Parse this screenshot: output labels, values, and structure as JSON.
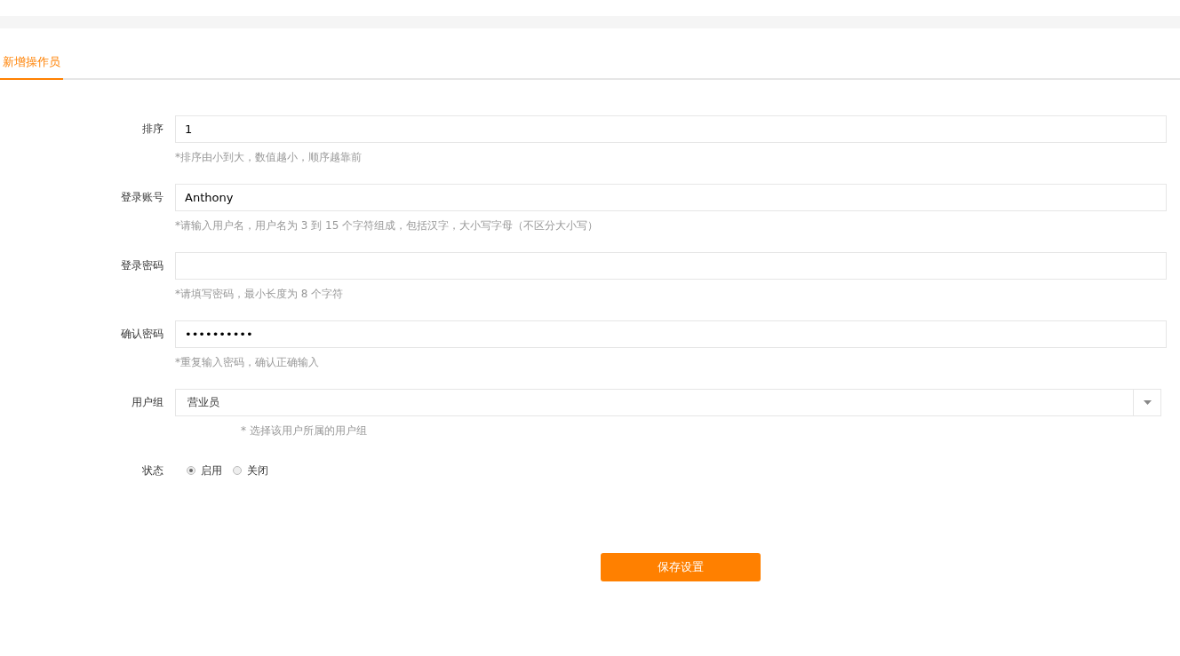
{
  "tabs": [
    {
      "label": "新增操作员",
      "selected": true
    }
  ],
  "fields": [
    {
      "kind": "text",
      "label": "排序",
      "value": "1",
      "help": "*排序由小到大，数值越小，顺序越靠前"
    },
    {
      "kind": "text",
      "label": "登录账号",
      "value": "Anthony",
      "help": "*请输入用户名，用户名为 3 到 15 个字符组成，包括汉字，大小写字母（不区分大小写）"
    },
    {
      "kind": "text",
      "label": "登录密码",
      "help": "*请填写密码，最小长度为 8 个字符"
    },
    {
      "kind": "text",
      "label": "确认密码",
      "value": "••••••••••",
      "help": "*重复输入密码，确认正确输入"
    },
    {
      "kind": "select",
      "label": "用户组",
      "value": "营业员",
      "help": "* 选择该用户所属的用户组"
    },
    {
      "kind": "radio",
      "label": "状态",
      "options": [
        {
          "label": "启用",
          "selected": true
        },
        {
          "label": "关闭",
          "selected": false
        }
      ]
    }
  ],
  "save_button": "保存设置"
}
